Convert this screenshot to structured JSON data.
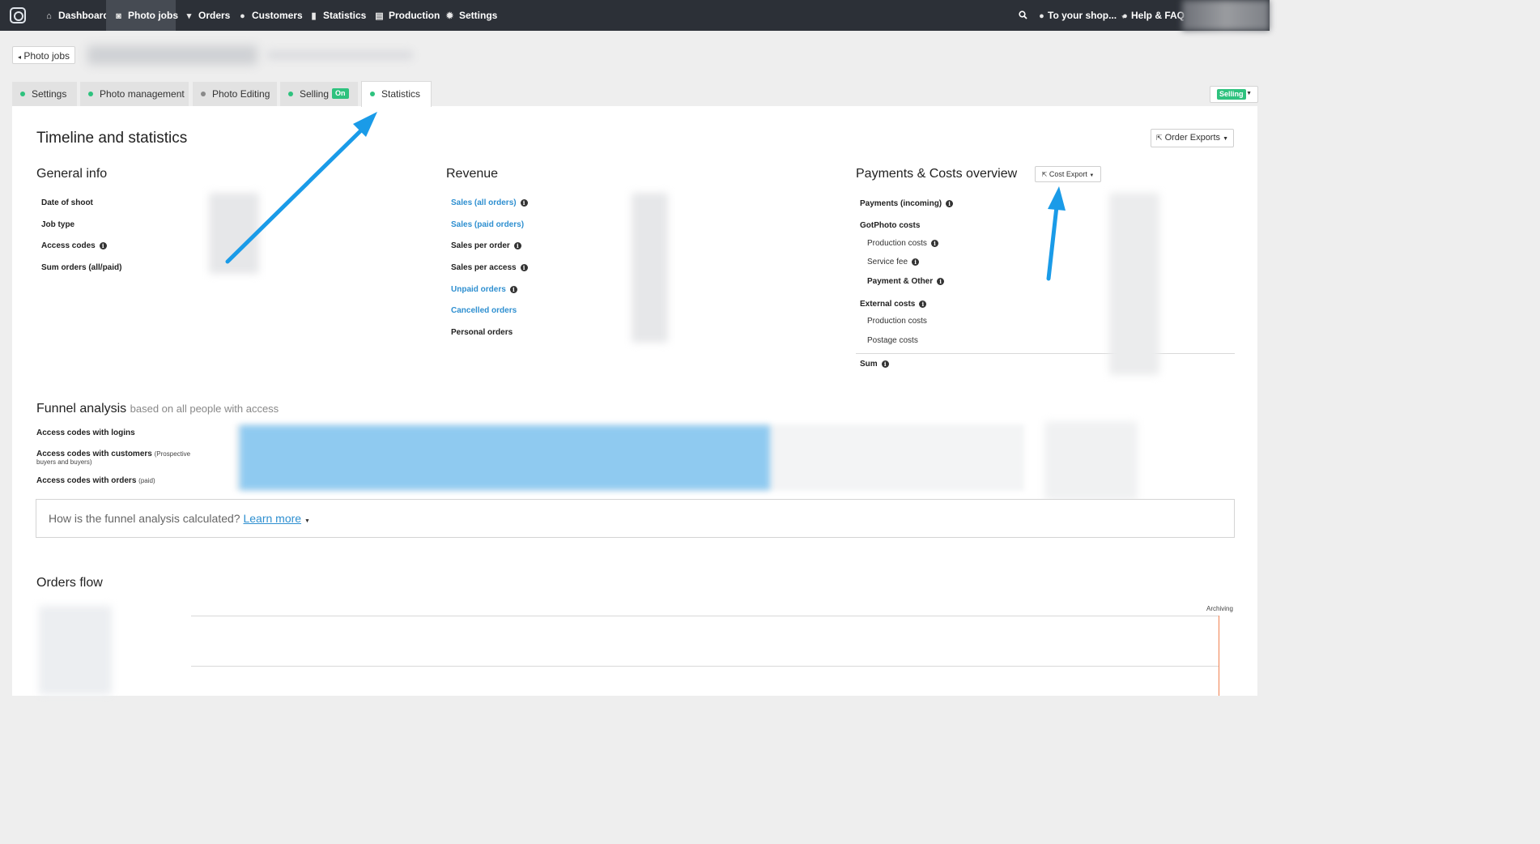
{
  "nav": {
    "items": [
      {
        "label": "Dashboard",
        "icon": "home-icon",
        "glyph": "⌂"
      },
      {
        "label": "Photo jobs",
        "icon": "camera-icon",
        "glyph": "◙"
      },
      {
        "label": "Orders",
        "icon": "cart-icon",
        "glyph": "▾"
      },
      {
        "label": "Customers",
        "icon": "user-icon",
        "glyph": "●"
      },
      {
        "label": "Statistics",
        "icon": "bar-chart-icon",
        "glyph": "▮"
      },
      {
        "label": "Production",
        "icon": "printer-icon",
        "glyph": "▤"
      },
      {
        "label": "Settings",
        "icon": "gear-icon",
        "glyph": "✹"
      }
    ],
    "shop_label": "To your shop...",
    "help_label": "Help & FAQ"
  },
  "header": {
    "back_label": "Photo jobs"
  },
  "tabs": [
    {
      "label": "Settings",
      "dot_color": "#2ec27e"
    },
    {
      "label": "Photo management",
      "dot_color": "#2ec27e"
    },
    {
      "label": "Photo Editing",
      "dot_color": "#8a8a8a"
    },
    {
      "label": "Selling",
      "dot_color": "#2ec27e",
      "badge": "On"
    },
    {
      "label": "Statistics",
      "dot_color": "#2ec27e"
    }
  ],
  "status_dropdown": {
    "label": "Selling"
  },
  "main": {
    "title": "Timeline and statistics",
    "order_exports_label": "Order Exports"
  },
  "general_info": {
    "heading": "General info",
    "rows": [
      "Date of shoot",
      "Job type",
      "Access codes",
      "Sum orders (all/paid)"
    ]
  },
  "revenue": {
    "heading": "Revenue",
    "rows": [
      "Sales (all orders)",
      "Sales (paid orders)",
      "Sales per order",
      "Sales per access",
      "Unpaid orders",
      "Cancelled orders",
      "Personal orders"
    ]
  },
  "payments": {
    "heading": "Payments & Costs overview",
    "cost_export_label": "Cost Export",
    "incoming": "Payments (incoming)",
    "gotphoto_costs": "GotPhoto costs",
    "production_costs": "Production costs",
    "service_fee": "Service fee",
    "payment_other": "Payment & Other",
    "external_costs": "External costs",
    "ext_production_costs": "Production costs",
    "postage_costs": "Postage costs",
    "sum": "Sum"
  },
  "funnel": {
    "heading": "Funnel analysis",
    "subheading": "based on all people with access",
    "row_logins": "Access codes with logins",
    "row_customers": "Access codes with customers",
    "row_customers_note": "(Prospective buyers and buyers)",
    "row_orders": "Access codes with orders",
    "row_orders_note": "(paid)",
    "question": "How is the funnel analysis calculated?",
    "learn_more": "Learn more"
  },
  "orders_flow": {
    "heading": "Orders flow",
    "marker_label": "Archiving"
  },
  "colors": {
    "nav_bg": "#2c3037",
    "accent_green": "#2ec27e",
    "link_blue": "#2e8fd0",
    "annotation_arrow": "#1a9be8"
  }
}
